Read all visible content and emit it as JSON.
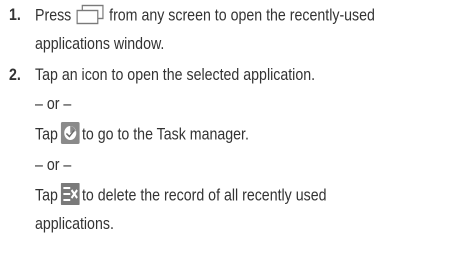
{
  "steps": [
    {
      "number": "1.",
      "line1_before": "Press",
      "line1_after": "from any screen to open the recently-used",
      "line2": "applications window."
    },
    {
      "number": "2.",
      "line1": "Tap an icon to open the selected application.",
      "or1": "– or –",
      "task_before": "Tap",
      "task_after": "to go to the Task manager.",
      "or2": "– or –",
      "clear_before": "Tap",
      "clear_after": "to delete the record of all recently used",
      "clear_line2": "applications."
    }
  ],
  "icons": {
    "recent": "recent-apps-icon",
    "task": "task-manager-icon",
    "clear": "clear-all-icon"
  },
  "colors": {
    "text": "#333333",
    "task_icon_bg": "#8a8a8a",
    "clear_icon_bg": "#7a7a7a"
  }
}
